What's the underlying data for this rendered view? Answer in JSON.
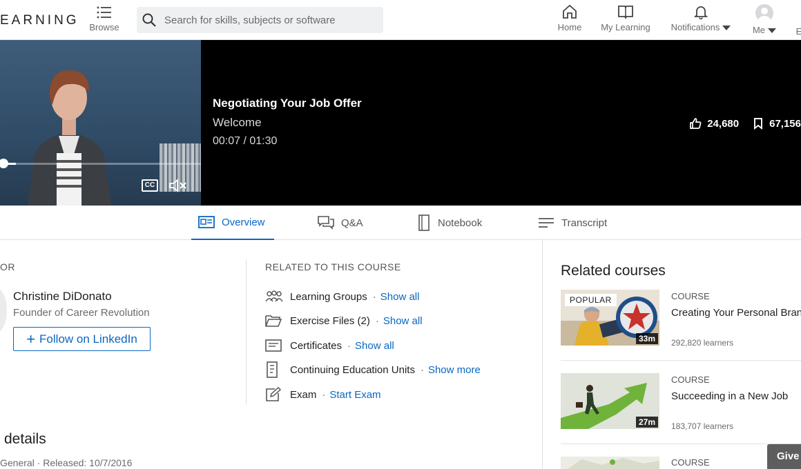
{
  "nav": {
    "brand": "EARNING",
    "browse_label": "Browse",
    "search_placeholder": "Search for skills, subjects or software",
    "items": [
      {
        "label": "Home"
      },
      {
        "label": "My Learning"
      },
      {
        "label": "Notifications"
      },
      {
        "label": "Me"
      },
      {
        "label": "E"
      }
    ]
  },
  "video": {
    "title": "Negotiating Your Job Offer",
    "chapter": "Welcome",
    "time": "00:07 / 01:30",
    "progress": 0.08,
    "cc_label": "CC",
    "likes": "24,680",
    "saves": "67,156"
  },
  "tabs": [
    {
      "label": "Overview",
      "active": true
    },
    {
      "label": "Q&A"
    },
    {
      "label": "Notebook"
    },
    {
      "label": "Transcript"
    }
  ],
  "instructor": {
    "section_label": "OR",
    "name": "Christine DiDonato",
    "role": "Founder of Career Revolution",
    "follow_label": "Follow on LinkedIn"
  },
  "related": {
    "section_label": "RELATED TO THIS COURSE",
    "rows": [
      {
        "label": "Learning Groups",
        "link": "Show all",
        "icon": "groups-icon"
      },
      {
        "label": "Exercise Files (2)",
        "link": "Show all",
        "icon": "folder-icon"
      },
      {
        "label": "Certificates",
        "link": "Show all",
        "icon": "certificate-icon"
      },
      {
        "label": "Continuing Education Units",
        "link": "Show more",
        "icon": "ceu-icon"
      },
      {
        "label": "Exam",
        "link": "Start Exam",
        "icon": "exam-icon"
      }
    ]
  },
  "details": {
    "title": "details",
    "meta": "General  ·  Released: 10/7/2016"
  },
  "related_courses": {
    "title": "Related courses",
    "items": [
      {
        "type": "COURSE",
        "name": "Creating Your Personal Brand",
        "learners": "292,820 learners",
        "duration": "33m",
        "badge": "POPULAR"
      },
      {
        "type": "COURSE",
        "name": "Succeeding in a New Job",
        "learners": "183,707 learners",
        "duration": "27m"
      },
      {
        "type": "COURSE"
      }
    ]
  },
  "give_feedback_label": "Give",
  "colors": {
    "accent": "#0a66c2",
    "hero_bg": "#000000"
  }
}
